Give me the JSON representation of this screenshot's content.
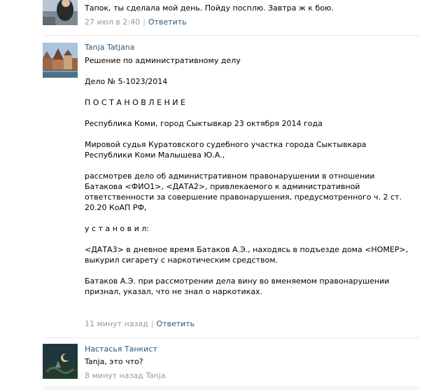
{
  "comments": [
    {
      "author": "",
      "text_lines": [
        "Тапок, ты сделала мой день. Пойду посплю. Завтра ж к бою."
      ],
      "time": "27 июл в 2:40",
      "reply_label": "Ответить"
    },
    {
      "author": "Tanja Tatjana",
      "paragraphs": [
        "Решение по административному делу",
        "Дело № 5-1023/2014",
        "П О С Т А Н О В Л Е Н И Е",
        "Республика Коми, город Сыктывкар 23 октября 2014 года",
        "Мировой судья Куратовского судебного участка города Сыктывкара Республики Коми Малышева Ю.А.,",
        "рассмотрев дело об административном правонарушении в отношении Батакова <ФИО1>, <ДАТА2>, привлекаемого к административной ответственности за совершение правонарушения, предусмотренного ч. 2 ст. 20.20 КоАП РФ,",
        "у с т а н о в и л:",
        "<ДАТА3> в дневное время Батаков А.Э., находясь в подъезде дома <НОМЕР>, выкурил сигарету с наркотическим средством.",
        "Батаков А.Э. при рассмотрении дела вину во вменяемом правонарушении признал, указал, что не знал о наркотиках."
      ],
      "time": "11 минут назад",
      "reply_label": "Ответить"
    },
    {
      "author": "Настасья Танкист",
      "text_lines": [
        "Tanja, это что?"
      ],
      "time": "8 минут назад",
      "reply_to": "Tanja"
    }
  ],
  "colors": {
    "link": "#2b587a",
    "meta": "#999999",
    "divider": "#e7eaed"
  }
}
